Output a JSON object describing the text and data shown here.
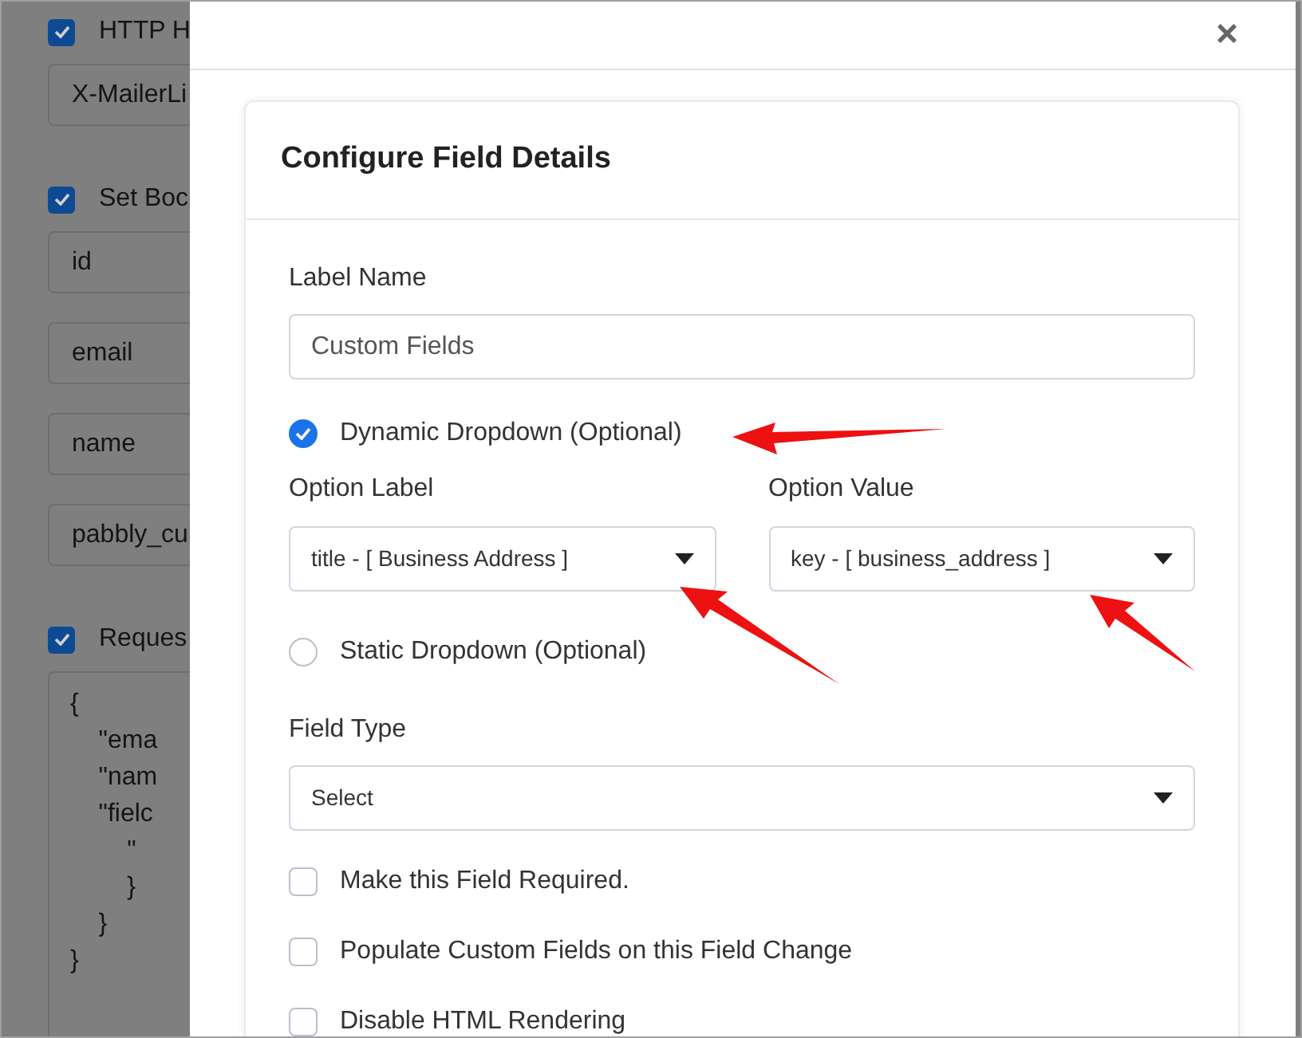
{
  "background": [
    {
      "kind": "checkbox",
      "label": "HTTP H",
      "checked": true
    },
    {
      "kind": "input",
      "value": "X-MailerLi"
    },
    {
      "kind": "checkbox",
      "label": "Set Boc",
      "checked": true
    },
    {
      "kind": "input",
      "value": "id"
    },
    {
      "kind": "input",
      "value": "email"
    },
    {
      "kind": "input",
      "value": "name"
    },
    {
      "kind": "input",
      "value": "pabbly_cu"
    },
    {
      "kind": "checkbox",
      "label": "Reques",
      "checked": true
    },
    {
      "kind": "code",
      "lines": [
        "{",
        "    \"ema",
        "    \"nam",
        "    \"fielc",
        "        \"",
        "        }",
        "    }",
        "}"
      ]
    }
  ],
  "modal": {
    "close": "×",
    "title": "Configure Field Details",
    "label_name": {
      "label": "Label Name",
      "value": "Custom Fields"
    },
    "dynamic_dropdown": {
      "label": "Dynamic Dropdown (Optional)",
      "selected": true
    },
    "option_label": {
      "label": "Option Label",
      "value": "title - [ Business Address ]"
    },
    "option_value": {
      "label": "Option Value",
      "value": "key - [ business_address ]"
    },
    "static_dropdown": {
      "label": "Static Dropdown (Optional)",
      "selected": false
    },
    "field_type": {
      "label": "Field Type",
      "value": "Select"
    },
    "checkboxes": [
      {
        "label": "Make this Field Required.",
        "checked": false
      },
      {
        "label": "Populate Custom Fields on this Field Change",
        "checked": false
      },
      {
        "label": "Disable HTML Rendering",
        "checked": false
      }
    ]
  }
}
